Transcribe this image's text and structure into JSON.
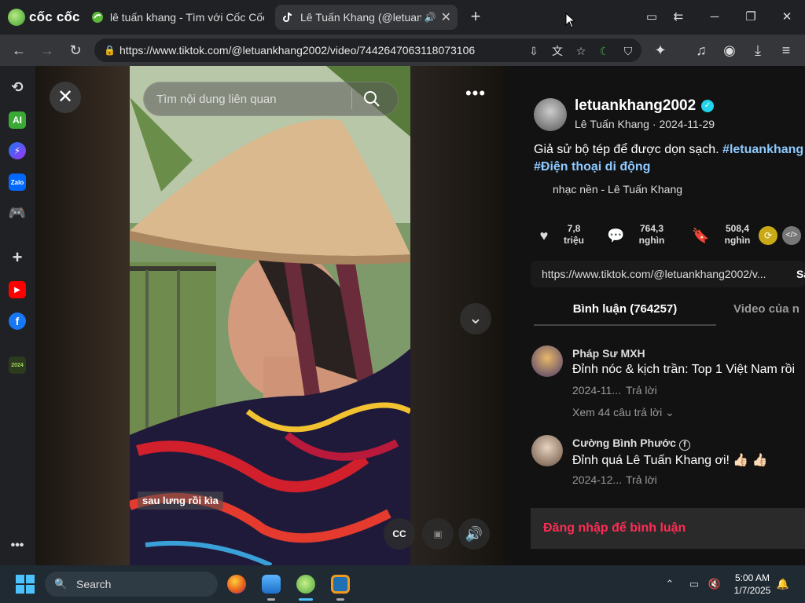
{
  "browser": {
    "logo_text": "cốc cốc",
    "tabs": [
      {
        "label": "lê tuấn khang - Tìm với Cốc Cốc"
      },
      {
        "label": "Lê Tuấn Khang (@letuan"
      }
    ],
    "url": "https://www.tiktok.com/@letuankhang2002/video/7442647063118073106"
  },
  "video": {
    "search_placeholder": "Tìm nội dung liên quan",
    "caption": "sau lưng rồi kìa",
    "cc_label": "CC"
  },
  "post": {
    "username": "letuankhang2002",
    "display_name": "Lê Tuấn Khang",
    "separator": " · ",
    "date": "2024-11-29",
    "description_text": "Giả sử bộ tép để được dọn sạch. ",
    "description_tag1": "#letuankhang",
    "description_tag2": "#Điện thoại di động",
    "music": "nhạc nền - Lê Tuấn Khang",
    "stats": {
      "likes_num": "7,8",
      "likes_unit": "triệu",
      "comments_num": "764,3",
      "comments_unit": "nghìn",
      "saves_num": "508,4",
      "saves_unit": "nghìn"
    },
    "link": "https://www.tiktok.com/@letuankhang2002/v...",
    "copy_label": "Sa",
    "tab_comments": "Bình luận (764257)",
    "tab_videos": "Video của n",
    "comments": [
      {
        "name": "Pháp Sư MXH",
        "text": "Đỉnh nóc & kịch trần: Top 1 Việt Nam rồi",
        "date": "2024-11...",
        "reply": "Trả lời"
      },
      {
        "name": "Cường Bình Phước",
        "text": "Đỉnh quá Lê Tuấn Khang ơi! 👍🏻 👍🏻",
        "date": "2024-12...",
        "reply": "Trả lời"
      }
    ],
    "more_replies": "Xem 44 câu trả lời",
    "login_prompt": "Đăng nhập để bình luận"
  },
  "taskbar": {
    "search_label": "Search",
    "time": "5:00 AM",
    "date": "1/7/2025"
  },
  "colors": {
    "accent_green": "#4caf50",
    "tiktok_red": "#fe2c55",
    "hashtag_blue": "#8ec9ff",
    "verified": "#20d5ec"
  },
  "icons": {
    "sidebar": [
      "history-icon",
      "ai-icon",
      "messenger-icon",
      "zalo-icon",
      "game-icon",
      "add-icon",
      "youtube-icon",
      "facebook-icon",
      "coccoc-2024-icon",
      "more-icon"
    ],
    "taskbar": [
      "firefox-icon",
      "photos-icon",
      "coccoc-icon",
      "vmware-icon"
    ]
  }
}
